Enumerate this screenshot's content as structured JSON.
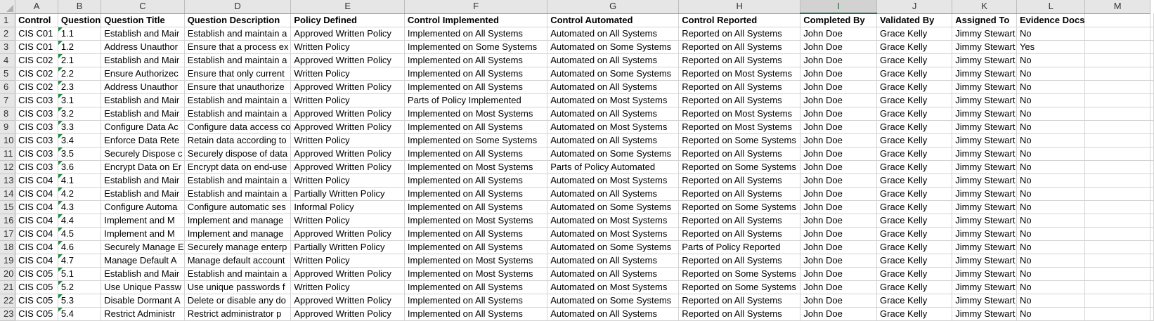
{
  "columns": [
    "A",
    "B",
    "C",
    "D",
    "E",
    "F",
    "G",
    "H",
    "I",
    "J",
    "K",
    "L",
    "M"
  ],
  "selected_column": "I",
  "headers": [
    "Control",
    "Question",
    "Question Title",
    "Question Description",
    "Policy Defined",
    "Control Implemented",
    "Control Automated",
    "Control Reported",
    "Completed By",
    "Validated By",
    "Assigned To",
    "Evidence Docs",
    ""
  ],
  "rows": [
    {
      "n": "2",
      "cells": [
        "CIS C01",
        "1.1",
        "Establish and Mair",
        "Establish and maintain a",
        "Approved Written Policy",
        "Implemented on All Systems",
        "Automated on All Systems",
        "Reported on All Systems",
        "John Doe",
        "Grace Kelly",
        "Jimmy Stewart",
        "No",
        ""
      ]
    },
    {
      "n": "3",
      "cells": [
        "CIS C01",
        "1.2",
        "Address Unauthor",
        "Ensure that a process ex",
        "Written Policy",
        "Implemented on Some Systems",
        "Automated on Some Systems",
        "Reported on All Systems",
        "John Doe",
        "Grace Kelly",
        "Jimmy Stewart",
        "Yes",
        ""
      ]
    },
    {
      "n": "4",
      "cells": [
        "CIS C02",
        "2.1",
        "Establish and Mair",
        "Establish and maintain a",
        "Approved Written Policy",
        "Implemented on All Systems",
        "Automated on All Systems",
        "Reported on All Systems",
        "John Doe",
        "Grace Kelly",
        "Jimmy Stewart",
        "No",
        ""
      ]
    },
    {
      "n": "5",
      "cells": [
        "CIS C02",
        "2.2",
        "Ensure Authorizec",
        "Ensure that only current",
        "Written Policy",
        "Implemented on All Systems",
        "Automated on Some Systems",
        "Reported on Most Systems",
        "John Doe",
        "Grace Kelly",
        "Jimmy Stewart",
        "No",
        ""
      ]
    },
    {
      "n": "6",
      "cells": [
        "CIS C02",
        "2.3",
        "Address Unauthor",
        "Ensure that unauthorize",
        "Approved Written Policy",
        "Implemented on All Systems",
        "Automated on All Systems",
        "Reported on All Systems",
        "John Doe",
        "Grace Kelly",
        "Jimmy Stewart",
        "No",
        ""
      ]
    },
    {
      "n": "7",
      "cells": [
        "CIS C03",
        "3.1",
        "Establish and Mair",
        "Establish and maintain a",
        "Written Policy",
        "Parts of Policy Implemented",
        "Automated on Most Systems",
        "Reported on All Systems",
        "John Doe",
        "Grace Kelly",
        "Jimmy Stewart",
        "No",
        ""
      ]
    },
    {
      "n": "8",
      "cells": [
        "CIS C03",
        "3.2",
        "Establish and Mair",
        "Establish and maintain a",
        "Approved Written Policy",
        "Implemented on Most Systems",
        "Automated on All Systems",
        "Reported on Most Systems",
        "John Doe",
        "Grace Kelly",
        "Jimmy Stewart",
        "No",
        ""
      ]
    },
    {
      "n": "9",
      "cells": [
        "CIS C03",
        "3.3",
        "Configure Data Ac",
        "Configure data access co",
        "Approved Written Policy",
        "Implemented on All Systems",
        "Automated on Most Systems",
        "Reported on Most Systems",
        "John Doe",
        "Grace Kelly",
        "Jimmy Stewart",
        "No",
        ""
      ]
    },
    {
      "n": "10",
      "cells": [
        "CIS C03",
        "3.4",
        "Enforce Data Rete",
        "Retain data according to",
        "Written Policy",
        "Implemented on Some Systems",
        "Automated on All Systems",
        "Reported on Some Systems",
        "John Doe",
        "Grace Kelly",
        "Jimmy Stewart",
        "No",
        ""
      ]
    },
    {
      "n": "11",
      "cells": [
        "CIS C03",
        "3.5",
        "Securely Dispose c",
        "Securely dispose of data",
        "Approved Written Policy",
        "Implemented on All Systems",
        "Automated on Some Systems",
        "Reported on All Systems",
        "John Doe",
        "Grace Kelly",
        "Jimmy Stewart",
        "No",
        ""
      ]
    },
    {
      "n": "12",
      "cells": [
        "CIS C03",
        "3.6",
        "Encrypt Data on Er",
        "Encrypt data on end-use",
        "Approved Written Policy",
        "Implemented on Most Systems",
        "Parts of Policy Automated",
        "Reported on Some Systems",
        "John Doe",
        "Grace Kelly",
        "Jimmy Stewart",
        "No",
        ""
      ]
    },
    {
      "n": "13",
      "cells": [
        "CIS C04",
        "4.1",
        "Establish and Mair",
        "Establish and maintain a",
        "Written Policy",
        "Implemented on All Systems",
        "Automated on Most Systems",
        "Reported on All Systems",
        "John Doe",
        "Grace Kelly",
        "Jimmy Stewart",
        "No",
        ""
      ]
    },
    {
      "n": "14",
      "cells": [
        "CIS C04",
        "4.2",
        "Establish and Mair",
        "Establish and maintain a",
        "Partially Written Policy",
        "Implemented on All Systems",
        "Automated on All Systems",
        "Reported on All Systems",
        "John Doe",
        "Grace Kelly",
        "Jimmy Stewart",
        "No",
        ""
      ]
    },
    {
      "n": "15",
      "cells": [
        "CIS C04",
        "4.3",
        "Configure Automa",
        "Configure automatic ses",
        "Informal Policy",
        "Implemented on All Systems",
        "Automated on Some Systems",
        "Reported on Some Systems",
        "John Doe",
        "Grace Kelly",
        "Jimmy Stewart",
        "No",
        ""
      ]
    },
    {
      "n": "16",
      "cells": [
        "CIS C04",
        "4.4",
        "Implement and M",
        "Implement and manage",
        "Written Policy",
        "Implemented on Most Systems",
        "Automated on Most Systems",
        "Reported on All Systems",
        "John Doe",
        "Grace Kelly",
        "Jimmy Stewart",
        "No",
        ""
      ]
    },
    {
      "n": "17",
      "cells": [
        "CIS C04",
        "4.5",
        "Implement and M",
        "Implement and manage",
        "Approved Written Policy",
        "Implemented on All Systems",
        "Automated on Most Systems",
        "Reported on All Systems",
        "John Doe",
        "Grace Kelly",
        "Jimmy Stewart",
        "No",
        ""
      ]
    },
    {
      "n": "18",
      "cells": [
        "CIS C04",
        "4.6",
        "Securely Manage E",
        "Securely manage enterp",
        "Partially Written Policy",
        "Implemented on All Systems",
        "Automated on Some Systems",
        "Parts of Policy Reported",
        "John Doe",
        "Grace Kelly",
        "Jimmy Stewart",
        "No",
        ""
      ]
    },
    {
      "n": "19",
      "cells": [
        "CIS C04",
        "4.7",
        "Manage Default A",
        "Manage default account",
        "Written Policy",
        "Implemented on Most Systems",
        "Automated on All Systems",
        "Reported on All Systems",
        "John Doe",
        "Grace Kelly",
        "Jimmy Stewart",
        "No",
        ""
      ]
    },
    {
      "n": "20",
      "cells": [
        "CIS C05",
        "5.1",
        "Establish and Mair",
        "Establish and maintain a",
        "Approved Written Policy",
        "Implemented on Most Systems",
        "Automated on All Systems",
        "Reported on Some Systems",
        "John Doe",
        "Grace Kelly",
        "Jimmy Stewart",
        "No",
        ""
      ]
    },
    {
      "n": "21",
      "cells": [
        "CIS C05",
        "5.2",
        "Use Unique Passw",
        "Use unique passwords f",
        "Written Policy",
        "Implemented on All Systems",
        "Automated on Most Systems",
        "Reported on Some Systems",
        "John Doe",
        "Grace Kelly",
        "Jimmy Stewart",
        "No",
        ""
      ]
    },
    {
      "n": "22",
      "cells": [
        "CIS C05",
        "5.3",
        "Disable Dormant A",
        "Delete or disable any do",
        "Approved Written Policy",
        "Implemented on All Systems",
        "Automated on Some Systems",
        "Reported on All Systems",
        "John Doe",
        "Grace Kelly",
        "Jimmy Stewart",
        "No",
        ""
      ]
    },
    {
      "n": "23",
      "cells": [
        "CIS C05",
        "5.4",
        "Restrict Administr",
        "Restrict administrator p",
        "Approved Written Policy",
        "Implemented on All Systems",
        "Automated on All Systems",
        "Reported on All Systems",
        "John Doe",
        "Grace Kelly",
        "Jimmy Stewart",
        "No",
        ""
      ]
    }
  ],
  "colors": {
    "selected_accent": "#217346",
    "header_bg": "#e6e6e6",
    "gridline": "#d4d4d4",
    "note_marker": "#1e8c3c"
  }
}
